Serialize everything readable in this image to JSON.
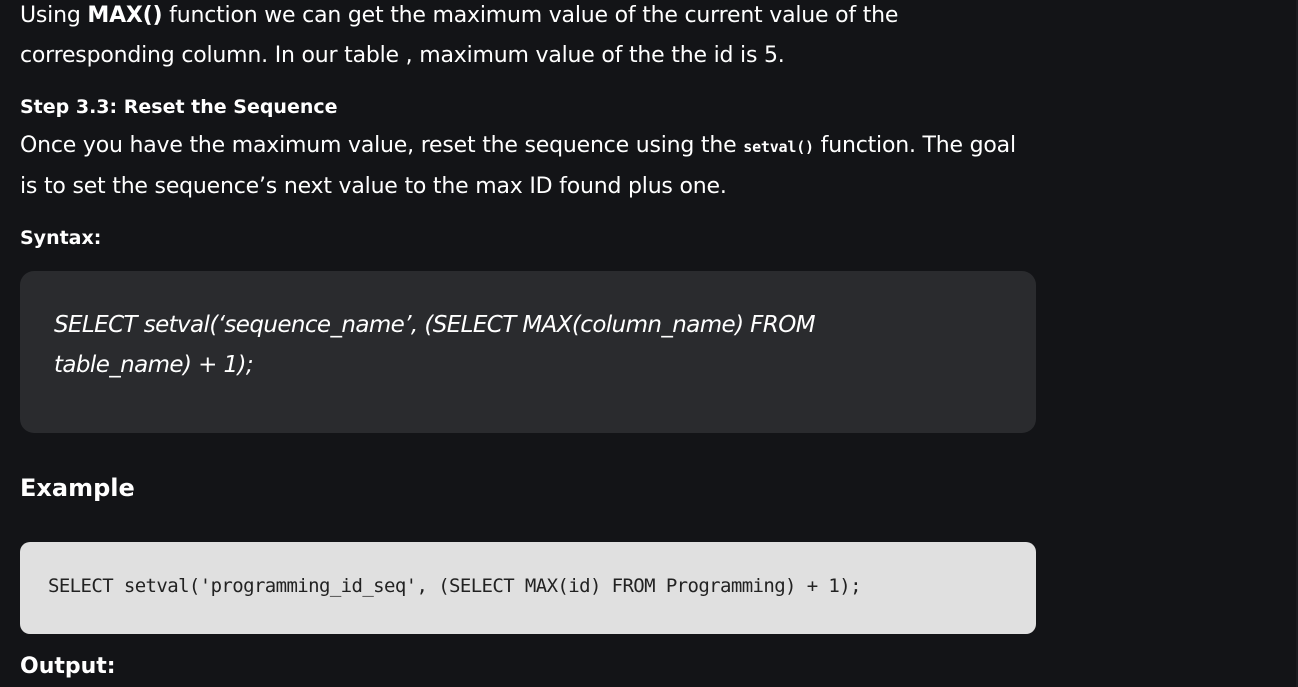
{
  "intro": {
    "text_before": "Using ",
    "bold": "MAX()",
    "text_after": " function we can get the maximum value of the current value of the corresponding column. In our table , maximum value of the the id is 5."
  },
  "step": {
    "heading": "Step 3.3: Reset the Sequence",
    "text_before": "Once you have the maximum value, reset the sequence using the ",
    "code": "setval()",
    "text_after": " function. The goal is to set the sequence’s next value to the max ID found plus one."
  },
  "syntax": {
    "label": "Syntax:",
    "text": "SELECT setval(‘sequence_name’, (SELECT MAX(column_name) FROM table_name) + 1);"
  },
  "example": {
    "heading": "Example",
    "code": "SELECT setval('programming_id_seq', (SELECT MAX(id) FROM Programming) + 1);"
  },
  "output": {
    "label": "Output:"
  },
  "colors": {
    "background": "#131417",
    "syntax_box": "#2a2b2e",
    "code_box": "#e0e0e0",
    "text": "#ffffff",
    "code_text": "#222222"
  }
}
